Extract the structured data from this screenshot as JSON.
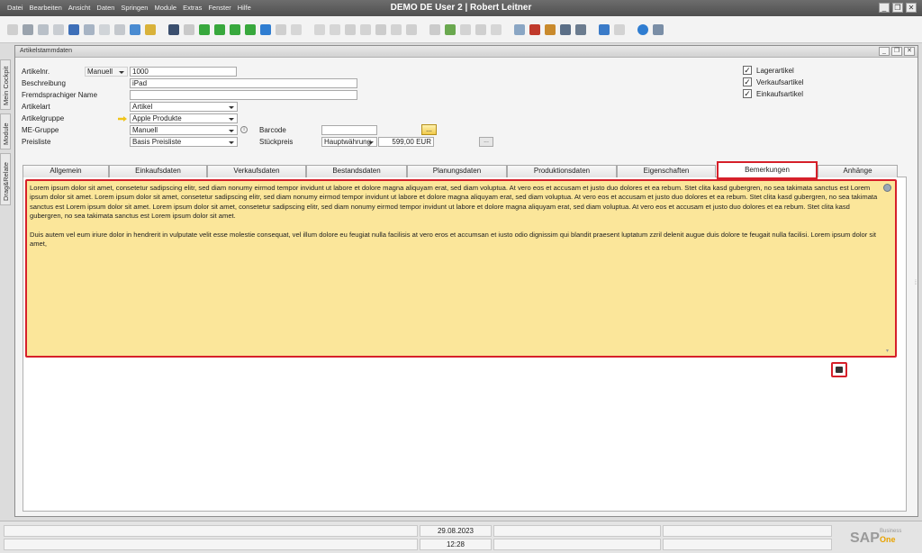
{
  "app": {
    "title": "DEMO DE User 2 | Robert Leitner",
    "menu": [
      "Datei",
      "Bearbeiten",
      "Ansicht",
      "Daten",
      "Springen",
      "Module",
      "Extras",
      "Fenster",
      "Hilfe"
    ]
  },
  "sidetabs": [
    "Mein Cockpit",
    "Module",
    "Drag&Relate"
  ],
  "window": {
    "title": "Artikelstammdaten"
  },
  "form": {
    "itemno_label": "Artikelnr.",
    "itemno_series": "Manuell",
    "itemno_value": "1000",
    "desc_label": "Beschreibung",
    "desc_value": "iPad",
    "foreign_label": "Fremdsprachiger Name",
    "foreign_value": "",
    "itemtype_label": "Artikelart",
    "itemtype_value": "Artikel",
    "itemgroup_label": "Artikelgruppe",
    "itemgroup_value": "Apple Produkte",
    "uomgroup_label": "ME-Gruppe",
    "uomgroup_value": "Manuell",
    "pricelist_label": "Preisliste",
    "pricelist_value": "Basis Preisliste",
    "barcode_label": "Barcode",
    "barcode_value": "",
    "barcode_button": "...",
    "unitprice_label": "Stückpreis",
    "currency_value": "Hauptwährung",
    "price_value": "599,00 EUR",
    "price_button": "..."
  },
  "checkboxes": [
    {
      "label": "Lagerartikel",
      "checked": true
    },
    {
      "label": "Verkaufsartikel",
      "checked": true
    },
    {
      "label": "Einkaufsartikel",
      "checked": true
    }
  ],
  "tabs": [
    "Allgemein",
    "Einkaufsdaten",
    "Verkaufsdaten",
    "Bestandsdaten",
    "Planungsdaten",
    "Produktionsdaten",
    "Eigenschaften",
    "Bemerkungen",
    "Anhänge"
  ],
  "active_tab": "Bemerkungen",
  "remarks": {
    "paragraph1": "Lorem ipsum dolor sit amet, consetetur sadipscing elitr, sed diam nonumy eirmod tempor invidunt ut labore et dolore magna aliquyam erat, sed diam voluptua. At vero eos et accusam et justo duo dolores et ea rebum. Stet clita kasd gubergren, no sea takimata sanctus est Lorem ipsum dolor sit amet. Lorem ipsum dolor sit amet, consetetur sadipscing elitr, sed diam nonumy eirmod tempor invidunt ut labore et dolore magna aliquyam erat, sed diam voluptua. At vero eos et accusam et justo duo dolores et ea rebum. Stet clita kasd gubergren, no sea takimata sanctus est Lorem ipsum dolor sit amet. Lorem ipsum dolor sit amet, consetetur sadipscing elitr, sed diam nonumy eirmod tempor invidunt ut labore et dolore magna aliquyam erat, sed diam voluptua. At vero eos et accusam et justo duo dolores et ea rebum. Stet clita kasd gubergren, no sea takimata sanctus est Lorem ipsum dolor sit amet.",
    "paragraph2": "Duis autem vel eum iriure dolor in hendrerit in vulputate velit esse molestie consequat, vel illum dolore eu feugiat nulla facilisis at vero eros et accumsan et iusto odio dignissim qui blandit praesent luptatum zzril delenit augue duis dolore te feugait nulla facilisi. Lorem ipsum dolor sit amet,"
  },
  "status": {
    "date": "29.08.2023",
    "time": "12:28"
  },
  "brand": {
    "name": "SAP",
    "line1": "Business",
    "line2": "One"
  }
}
